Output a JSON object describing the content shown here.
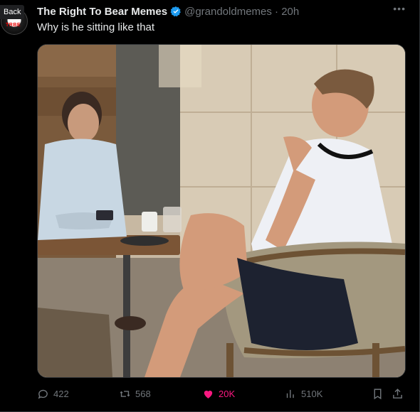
{
  "nav": {
    "back_label": "Back"
  },
  "avatar": {
    "text": "TRBE"
  },
  "tweet": {
    "display_name": "The Right To Bear Memes",
    "handle": "@grandoldmemes · 20h",
    "text": "Why is he sitting like that"
  },
  "metrics": {
    "replies": "422",
    "reposts": "568",
    "likes": "20K",
    "views": "510K"
  },
  "colors": {
    "background": "#000000",
    "text": "#e7e9ea",
    "muted": "#71767b",
    "like": "#f91880",
    "verified": "#1d9bf0"
  }
}
